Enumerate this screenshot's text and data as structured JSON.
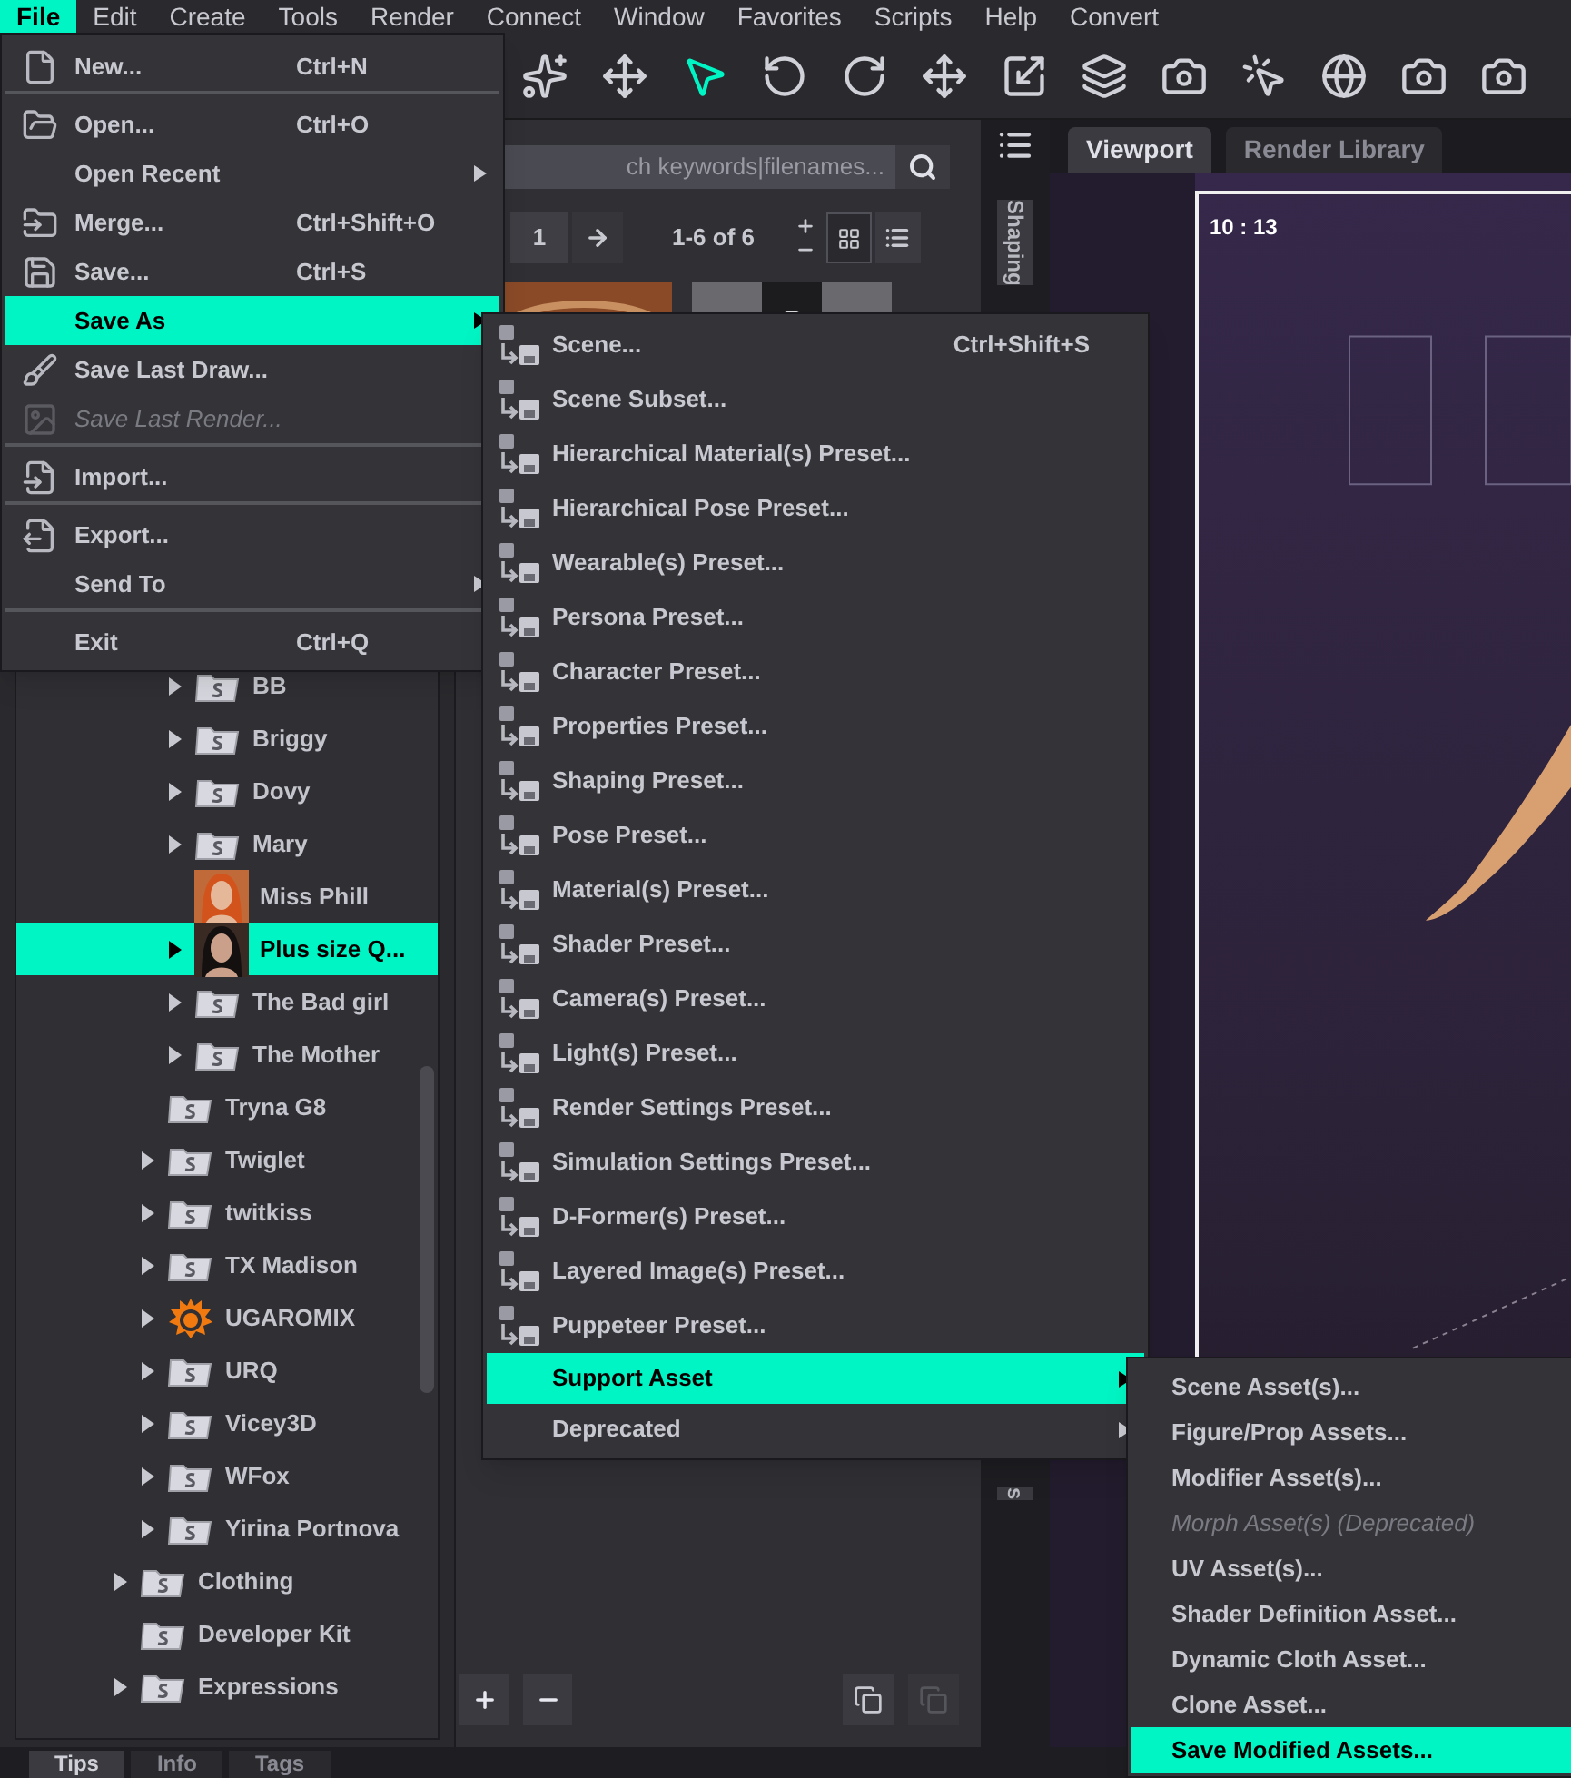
{
  "menu_bar": [
    {
      "label": "File",
      "selected": true
    },
    {
      "label": "Edit",
      "selected": false
    },
    {
      "label": "Create",
      "selected": false
    },
    {
      "label": "Tools",
      "selected": false
    },
    {
      "label": "Render",
      "selected": false
    },
    {
      "label": "Connect",
      "selected": false
    },
    {
      "label": "Window",
      "selected": false
    },
    {
      "label": "Favorites",
      "selected": false
    },
    {
      "label": "Scripts",
      "selected": false
    },
    {
      "label": "Help",
      "selected": false
    },
    {
      "label": "Convert",
      "selected": false
    }
  ],
  "toolbar": [
    {
      "selected": false
    },
    {
      "selected": false
    },
    {
      "selected": true
    },
    {
      "selected": false
    },
    {
      "selected": false
    },
    {
      "selected": false
    },
    {
      "selected": false
    },
    {
      "selected": false
    },
    {
      "selected": false
    },
    {
      "selected": false
    },
    {
      "selected": false
    },
    {
      "selected": false
    },
    {
      "selected": false
    }
  ],
  "file_menu": [
    {
      "label": "New...",
      "shortcut": "Ctrl+N",
      "submenu": false,
      "selected": false,
      "disabled": false,
      "separator_before": false
    },
    {
      "label": "Open...",
      "shortcut": "Ctrl+O",
      "submenu": false,
      "selected": false,
      "disabled": false,
      "separator_before": true
    },
    {
      "label": "Open Recent",
      "submenu": true,
      "selected": false,
      "disabled": false,
      "separator_before": false
    },
    {
      "label": "Merge...",
      "shortcut": "Ctrl+Shift+O",
      "submenu": false,
      "selected": false,
      "disabled": false,
      "separator_before": false
    },
    {
      "label": "Save...",
      "shortcut": "Ctrl+S",
      "submenu": false,
      "selected": false,
      "disabled": false,
      "separator_before": false
    },
    {
      "label": "Save As",
      "submenu": true,
      "selected": true,
      "disabled": false,
      "separator_before": false
    },
    {
      "label": "Save Last Draw...",
      "submenu": false,
      "selected": false,
      "disabled": false,
      "separator_before": false
    },
    {
      "label": "Save Last Render...",
      "submenu": false,
      "selected": false,
      "disabled": true,
      "separator_before": false
    },
    {
      "label": "Import...",
      "submenu": false,
      "selected": false,
      "disabled": false,
      "separator_before": true
    },
    {
      "label": "Export...",
      "submenu": false,
      "selected": false,
      "disabled": false,
      "separator_before": true
    },
    {
      "label": "Send To",
      "submenu": true,
      "selected": false,
      "disabled": false,
      "separator_before": false
    },
    {
      "label": "Exit",
      "shortcut": "Ctrl+Q",
      "submenu": false,
      "selected": false,
      "disabled": false,
      "separator_before": true
    }
  ],
  "save_as_menu": [
    {
      "label": "Scene...",
      "shortcut": "Ctrl+Shift+S",
      "kind": "preset",
      "submenu": false,
      "selected": false
    },
    {
      "label": "Scene Subset...",
      "kind": "preset",
      "submenu": false,
      "selected": false
    },
    {
      "label": "Hierarchical Material(s) Preset...",
      "kind": "preset",
      "submenu": false,
      "selected": false
    },
    {
      "label": "Hierarchical Pose Preset...",
      "kind": "preset",
      "submenu": false,
      "selected": false
    },
    {
      "label": "Wearable(s) Preset...",
      "kind": "preset",
      "submenu": false,
      "selected": false
    },
    {
      "label": "Persona Preset...",
      "kind": "preset",
      "submenu": false,
      "selected": false
    },
    {
      "label": "Character Preset...",
      "kind": "preset",
      "submenu": false,
      "selected": false
    },
    {
      "label": "Properties Preset...",
      "kind": "preset",
      "submenu": false,
      "selected": false
    },
    {
      "label": "Shaping Preset...",
      "kind": "preset",
      "submenu": false,
      "selected": false
    },
    {
      "label": "Pose Preset...",
      "kind": "preset",
      "submenu": false,
      "selected": false
    },
    {
      "label": "Material(s) Preset...",
      "kind": "preset",
      "submenu": false,
      "selected": false
    },
    {
      "label": "Shader Preset...",
      "kind": "preset",
      "submenu": false,
      "selected": false
    },
    {
      "label": "Camera(s) Preset...",
      "kind": "preset",
      "submenu": false,
      "selected": false
    },
    {
      "label": "Light(s) Preset...",
      "kind": "preset",
      "submenu": false,
      "selected": false
    },
    {
      "label": "Render Settings Preset...",
      "kind": "preset",
      "submenu": false,
      "selected": false
    },
    {
      "label": "Simulation Settings Preset...",
      "kind": "preset",
      "submenu": false,
      "selected": false
    },
    {
      "label": "D-Former(s) Preset...",
      "kind": "preset",
      "submenu": false,
      "selected": false
    },
    {
      "label": "Layered Image(s) Preset...",
      "kind": "preset",
      "submenu": false,
      "selected": false
    },
    {
      "label": "Puppeteer Preset...",
      "kind": "preset",
      "submenu": false,
      "selected": false
    },
    {
      "label": "Support Asset",
      "kind": "group",
      "submenu": true,
      "selected": true
    },
    {
      "label": "Deprecated",
      "kind": "group",
      "submenu": true,
      "selected": false
    }
  ],
  "support_asset_menu": [
    {
      "label": "Scene Asset(s)...",
      "selected": false,
      "disabled": false
    },
    {
      "label": "Figure/Prop Assets...",
      "selected": false,
      "disabled": false
    },
    {
      "label": "Modifier Asset(s)...",
      "selected": false,
      "disabled": false
    },
    {
      "label": "Morph Asset(s) (Deprecated)",
      "selected": false,
      "disabled": true
    },
    {
      "label": "UV Asset(s)...",
      "selected": false,
      "disabled": false
    },
    {
      "label": "Shader Definition Asset...",
      "selected": false,
      "disabled": false
    },
    {
      "label": "Dynamic Cloth Asset...",
      "selected": false,
      "disabled": false
    },
    {
      "label": "Clone Asset...",
      "selected": false,
      "disabled": false
    },
    {
      "label": "Save Modified Assets...",
      "selected": true,
      "disabled": false
    }
  ],
  "content_library": {
    "search": {
      "placeholder": "ch keywords|filenames..."
    },
    "page": "1",
    "range": "1-6 of 6",
    "tree": [
      {
        "children": [
          {
            "children": [
              {
                "label": "BB",
                "kind": "folder",
                "expandable": true,
                "selected": false
              },
              {
                "label": "Briggy",
                "kind": "folder",
                "expandable": true,
                "selected": false
              },
              {
                "label": "Dovy",
                "kind": "folder",
                "expandable": true,
                "selected": false
              },
              {
                "label": "Mary",
                "kind": "folder",
                "expandable": true,
                "selected": false
              },
              {
                "label": "Miss Phill",
                "kind": "portrait",
                "expandable": false,
                "selected": false
              },
              {
                "label": "Plus size Q...",
                "kind": "portrait",
                "expandable": true,
                "selected": true
              },
              {
                "label": "The Bad girl",
                "kind": "folder",
                "expandable": true,
                "selected": false
              },
              {
                "label": "The Mother",
                "kind": "folder",
                "expandable": true,
                "selected": false
              }
            ]
          },
          {
            "label": "Tryna G8",
            "kind": "folder",
            "expandable": false,
            "selected": false
          },
          {
            "label": "Twiglet",
            "kind": "folder",
            "expandable": true,
            "selected": false
          },
          {
            "label": "twitkiss",
            "kind": "folder",
            "expandable": true,
            "selected": false
          },
          {
            "label": "TX Madison",
            "kind": "folder",
            "expandable": true,
            "selected": false
          },
          {
            "label": "UGAROMIX",
            "kind": "logo",
            "expandable": true,
            "selected": false
          },
          {
            "label": "URQ",
            "kind": "folder",
            "expandable": true,
            "selected": false
          },
          {
            "label": "Vicey3D",
            "kind": "folder",
            "expandable": true,
            "selected": false
          },
          {
            "label": "WFox",
            "kind": "folder",
            "expandable": true,
            "selected": false
          },
          {
            "label": "Yirina Portnova",
            "kind": "folder",
            "expandable": true,
            "selected": false
          }
        ]
      },
      {
        "label": "Clothing",
        "kind": "folder",
        "expandable": true,
        "selected": false
      },
      {
        "label": "Developer Kit",
        "kind": "folder",
        "expandable": false,
        "selected": false
      },
      {
        "label": "Expressions",
        "kind": "folder",
        "expandable": true,
        "selected": false
      }
    ]
  },
  "side_tabs": [
    {
      "label": "Shaping"
    },
    {
      "label": "s"
    }
  ],
  "viewport": {
    "tabs": [
      {
        "label": "Viewport",
        "selected": true
      },
      {
        "label": "Render Library",
        "selected": false
      }
    ],
    "aspect_label": "10 : 13"
  },
  "bottom_tabs": [
    {
      "label": "Tips",
      "selected": true
    },
    {
      "label": "Info",
      "selected": false
    },
    {
      "label": "Tags",
      "selected": false
    }
  ]
}
